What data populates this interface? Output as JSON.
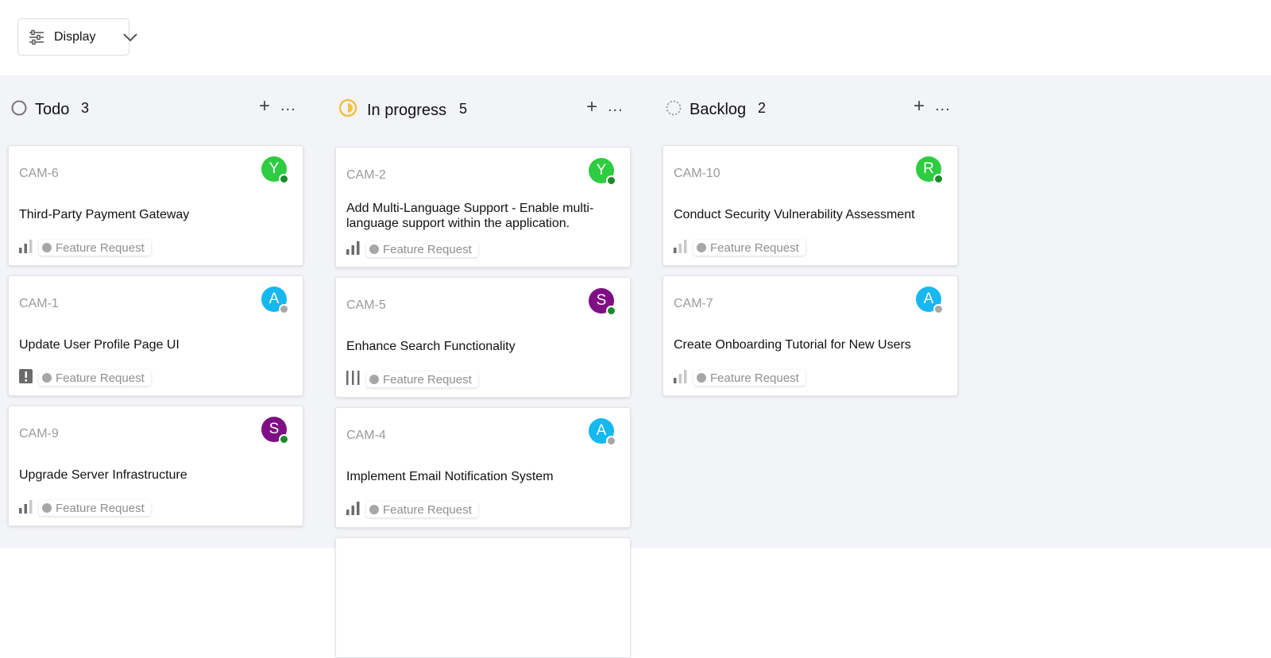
{
  "toolbar": {
    "display_label": "Display"
  },
  "columns": [
    {
      "title": "Todo",
      "count": "3",
      "status_icon": "circle-empty-icon",
      "cards": [
        {
          "id": "CAM-6",
          "title": "Third-Party Payment Gateway",
          "assignee": "Y",
          "avatar_color": "#2ecc40",
          "presence": "online",
          "priority": "medium-bars",
          "label": "Feature Request"
        },
        {
          "id": "CAM-1",
          "title": "Update User Profile Page UI",
          "assignee": "A",
          "avatar_color": "#15b8ef",
          "presence": "offline",
          "priority": "urgent",
          "label": "Feature Request"
        },
        {
          "id": "CAM-9",
          "title": "Upgrade Server Infrastructure",
          "assignee": "S",
          "avatar_color": "#7f0f84",
          "presence": "online",
          "priority": "medium-bars",
          "label": "Feature Request"
        }
      ]
    },
    {
      "title": "In progress",
      "count": "5",
      "status_icon": "half-circle-icon",
      "cards": [
        {
          "id": "CAM-2",
          "title": "Add Multi-Language Support - Enable multi-language support within the application.",
          "assignee": "Y",
          "avatar_color": "#2ecc40",
          "presence": "online",
          "priority": "high-bars",
          "label": "Feature Request"
        },
        {
          "id": "CAM-5",
          "title": "Enhance Search Functionality",
          "assignee": "S",
          "avatar_color": "#7f0f84",
          "presence": "online",
          "priority": "no-priority",
          "label": "Feature Request"
        },
        {
          "id": "CAM-4",
          "title": "Implement Email Notification System",
          "assignee": "A",
          "avatar_color": "#15b8ef",
          "presence": "offline",
          "priority": "high-bars",
          "label": "Feature Request"
        }
      ]
    },
    {
      "title": "Backlog",
      "count": "2",
      "status_icon": "dashed-circle-icon",
      "cards": [
        {
          "id": "CAM-10",
          "title": "Conduct Security Vulnerability Assessment",
          "assignee": "R",
          "avatar_color": "#2ecc40",
          "presence": "online",
          "priority": "low-bars",
          "label": "Feature Request"
        },
        {
          "id": "CAM-7",
          "title": "Create Onboarding Tutorial for New Users",
          "assignee": "A",
          "avatar_color": "#15b8ef",
          "presence": "offline",
          "priority": "low-bars",
          "label": "Feature Request"
        }
      ]
    }
  ],
  "colors": {
    "online": "#1a8a2a",
    "offline": "#a7a7a7",
    "in_progress": "#f0c24b",
    "board_bg": "#f3f4f7"
  }
}
